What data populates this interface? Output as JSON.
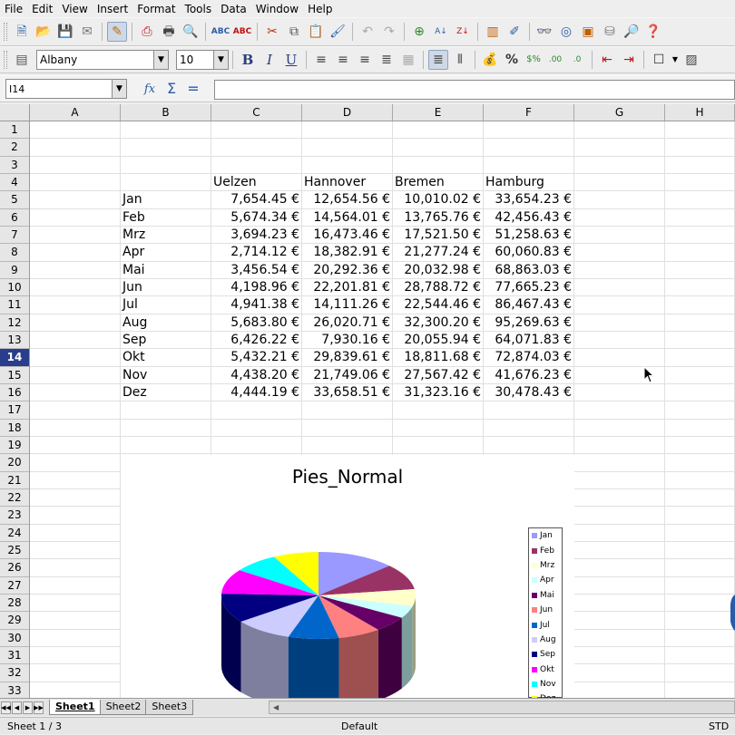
{
  "menu": [
    "File",
    "Edit",
    "View",
    "Insert",
    "Format",
    "Tools",
    "Data",
    "Window",
    "Help"
  ],
  "toolbar": {
    "font_name": "Albany",
    "font_size": "10",
    "bold": "B",
    "italic": "I",
    "underline": "U"
  },
  "formula_bar": {
    "cell_ref": "I14",
    "fx": "fx",
    "sum": "Σ",
    "equals": "="
  },
  "columns": [
    "A",
    "B",
    "C",
    "D",
    "E",
    "F",
    "G",
    "H"
  ],
  "rows": [
    "1",
    "2",
    "3",
    "4",
    "5",
    "6",
    "7",
    "8",
    "9",
    "10",
    "11",
    "12",
    "13",
    "14",
    "15",
    "16",
    "17",
    "18",
    "19",
    "20",
    "21",
    "22",
    "23",
    "24",
    "25",
    "26",
    "27",
    "28",
    "29",
    "30",
    "31",
    "32",
    "33"
  ],
  "selected_row": "14",
  "sheet": {
    "headers": [
      "Uelzen",
      "Hannover",
      "Bremen",
      "Hamburg"
    ],
    "data": [
      [
        "Jan",
        "7,654.45 €",
        "12,654.56 €",
        "10,010.02 €",
        "33,654.23 €"
      ],
      [
        "Feb",
        "5,674.34 €",
        "14,564.01 €",
        "13,765.76 €",
        "42,456.43 €"
      ],
      [
        "Mrz",
        "3,694.23 €",
        "16,473.46 €",
        "17,521.50 €",
        "51,258.63 €"
      ],
      [
        "Apr",
        "2,714.12 €",
        "18,382.91 €",
        "21,277.24 €",
        "60,060.83 €"
      ],
      [
        "Mai",
        "3,456.54 €",
        "20,292.36 €",
        "20,032.98 €",
        "68,863.03 €"
      ],
      [
        "Jun",
        "4,198.96 €",
        "22,201.81 €",
        "28,788.72 €",
        "77,665.23 €"
      ],
      [
        "Jul",
        "4,941.38 €",
        "14,111.26 €",
        "22,544.46 €",
        "86,467.43 €"
      ],
      [
        "Aug",
        "5,683.80 €",
        "26,020.71 €",
        "32,300.20 €",
        "95,269.63 €"
      ],
      [
        "Sep",
        "6,426.22 €",
        "7,930.16 €",
        "20,055.94 €",
        "64,071.83 €"
      ],
      [
        "Okt",
        "5,432.21 €",
        "29,839.61 €",
        "18,811.68 €",
        "72,874.03 €"
      ],
      [
        "Nov",
        "4,438.20 €",
        "21,749.06 €",
        "27,567.42 €",
        "41,676.23 €"
      ],
      [
        "Dez",
        "4,444.19 €",
        "33,658.51 €",
        "31,323.16 €",
        "30,478.43 €"
      ]
    ]
  },
  "chart_data": {
    "type": "pie",
    "title": "Pies_Normal",
    "categories": [
      "Jan",
      "Feb",
      "Mrz",
      "Apr",
      "Mai",
      "Jun",
      "Jul",
      "Aug",
      "Sep",
      "Okt",
      "Nov",
      "Dez"
    ],
    "values": [
      7654.45,
      5674.34,
      3694.23,
      2714.12,
      3456.54,
      4198.96,
      4941.38,
      5683.8,
      6426.22,
      5432.21,
      4438.2,
      4444.19
    ],
    "colors": [
      "#9999ff",
      "#993366",
      "#ffffcc",
      "#ccffff",
      "#660066",
      "#ff8080",
      "#0066cc",
      "#ccccff",
      "#000080",
      "#ff00ff",
      "#00ffff",
      "#ffff00"
    ],
    "legend_position": "right"
  },
  "tabs": [
    "Sheet1",
    "Sheet2",
    "Sheet3"
  ],
  "status": {
    "sheet": "Sheet 1 / 3",
    "style": "Default",
    "mode": "STD"
  }
}
